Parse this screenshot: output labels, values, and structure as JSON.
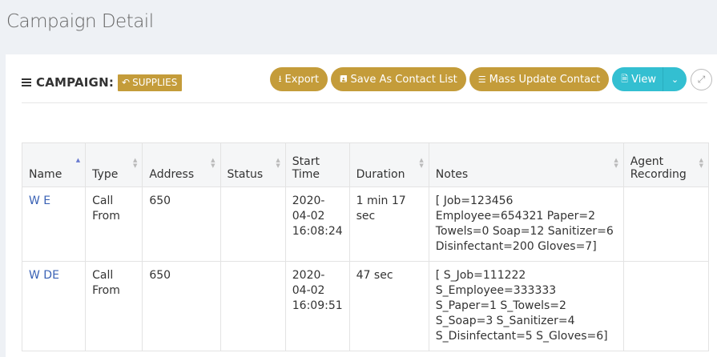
{
  "page": {
    "title": "Campaign Detail"
  },
  "panel": {
    "label": "CAMPAIGN:",
    "tag": "SUPPLIES",
    "buttons": {
      "export": "Export",
      "save_contact_list": "Save As Contact List",
      "mass_update": "Mass Update Contact",
      "view": "View"
    }
  },
  "table": {
    "headers": [
      "Name",
      "Type",
      "Address",
      "Status",
      "Start Time",
      "Duration",
      "Notes",
      "Agent Recording"
    ],
    "rows": [
      {
        "name": "W E",
        "type": "Call From",
        "address": "650",
        "status": "",
        "start_time": "2020-04-02 16:08:24",
        "duration": "1 min 17 sec",
        "notes": "[ Job=123456 Employee=654321 Paper=2 Towels=0 Soap=12 Sanitizer=6 Disinfectant=200 Gloves=7]",
        "recording": ""
      },
      {
        "name": "W DE",
        "type": "Call From",
        "address": "650",
        "status": "",
        "start_time": "2020-04-02 16:09:51",
        "duration": "47 sec",
        "notes": "[ S_Job=111222 S_Employee=333333 S_Paper=1 S_Towels=2 S_Soap=3 S_Sanitizer=4 S_Disinfectant=5 S_Gloves=6]",
        "recording": ""
      }
    ]
  },
  "colors": {
    "gold": "#c49c3a",
    "teal": "#33bfd1",
    "link": "#3a62b5"
  }
}
